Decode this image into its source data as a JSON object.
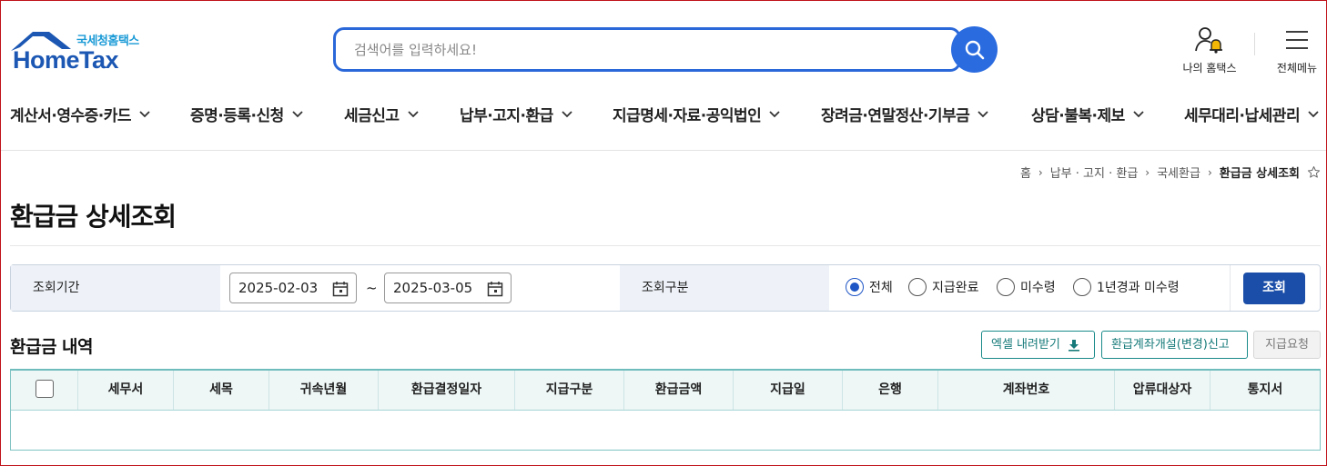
{
  "header": {
    "logo_sub": "국세청홈택스",
    "logo_main": "HomeTax",
    "search_placeholder": "검색어를 입력하세요!",
    "my_hometax_label": "나의 홈택스",
    "all_menu_label": "전체메뉴"
  },
  "gnb": {
    "items": [
      {
        "label": "계산서·영수증·카드"
      },
      {
        "label": "증명·등록·신청"
      },
      {
        "label": "세금신고"
      },
      {
        "label": "납부·고지·환급"
      },
      {
        "label": "지급명세·자료·공익법인"
      },
      {
        "label": "장려금·연말정산·기부금"
      },
      {
        "label": "상담·불복·제보"
      },
      {
        "label": "세무대리·납세관리"
      }
    ]
  },
  "breadcrumb": {
    "home": "홈",
    "level1": "납부 · 고지 · 환급",
    "level2": "국세환급",
    "current": "환급금 상세조회"
  },
  "page_title": "환급금 상세조회",
  "filter": {
    "period_label": "조회기간",
    "start_date": "2025-02-03",
    "tilde": "~",
    "end_date": "2025-03-05",
    "type_label": "조회구분",
    "options": [
      {
        "label": "전체",
        "selected": true
      },
      {
        "label": "지급완료",
        "selected": false
      },
      {
        "label": "미수령",
        "selected": false
      },
      {
        "label": "1년경과 미수령",
        "selected": false
      }
    ],
    "search_button": "조회"
  },
  "section": {
    "title": "환급금 내역",
    "excel_button": "엑셀 내려받기",
    "account_button": "환급계좌개설(변경)신고",
    "pay_request_button": "지급요청"
  },
  "table": {
    "columns": [
      "세무서",
      "세목",
      "귀속년월",
      "환급결정일자",
      "지급구분",
      "환급금액",
      "지급일",
      "은행",
      "계좌번호",
      "압류대상자",
      "통지서"
    ],
    "rows": []
  },
  "colors": {
    "primary_blue": "#2a67d8",
    "navy_button": "#1b4ea8",
    "teal_accent": "#177a7a",
    "table_header_bg": "#eef6f6"
  }
}
